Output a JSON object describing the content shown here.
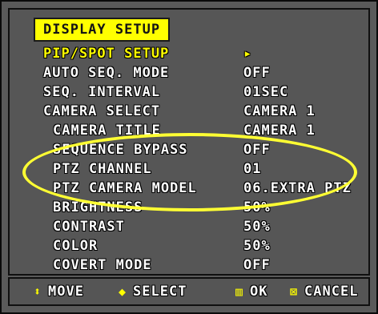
{
  "title": "DISPLAY SETUP",
  "rows": [
    {
      "label": "PIP/SPOT SETUP",
      "value": "▸"
    },
    {
      "label": "AUTO SEQ. MODE",
      "value": "OFF"
    },
    {
      "label": "SEQ. INTERVAL",
      "value": "01SEC"
    },
    {
      "label": "CAMERA SELECT",
      "value": "CAMERA 1"
    },
    {
      "label": "CAMERA TITLE",
      "value": "CAMERA 1"
    },
    {
      "label": "SEQUENCE BYPASS",
      "value": "OFF"
    },
    {
      "label": "PTZ CHANNEL",
      "value": "01"
    },
    {
      "label": "PTZ CAMERA MODEL",
      "value": "06.EXTRA PTZ"
    },
    {
      "label": "BRIGHTNESS",
      "value": "50%"
    },
    {
      "label": "CONTRAST",
      "value": "50%"
    },
    {
      "label": "COLOR",
      "value": "50%"
    },
    {
      "label": "COVERT MODE",
      "value": "OFF"
    }
  ],
  "footer": {
    "move": {
      "icon": "up-down-arrows-icon",
      "glyph": "⬍",
      "label": "MOVE"
    },
    "select": {
      "icon": "left-right-arrows-icon",
      "glyph": "◆",
      "label": "SELECT"
    },
    "ok": {
      "icon": "square-icon",
      "glyph": "▥",
      "label": "OK"
    },
    "cancel": {
      "icon": "x-box-icon",
      "glyph": "⊠",
      "label": "CANCEL"
    }
  },
  "colors": {
    "highlight": "#ffff00",
    "text": "#ffffff",
    "background": "#565656"
  }
}
